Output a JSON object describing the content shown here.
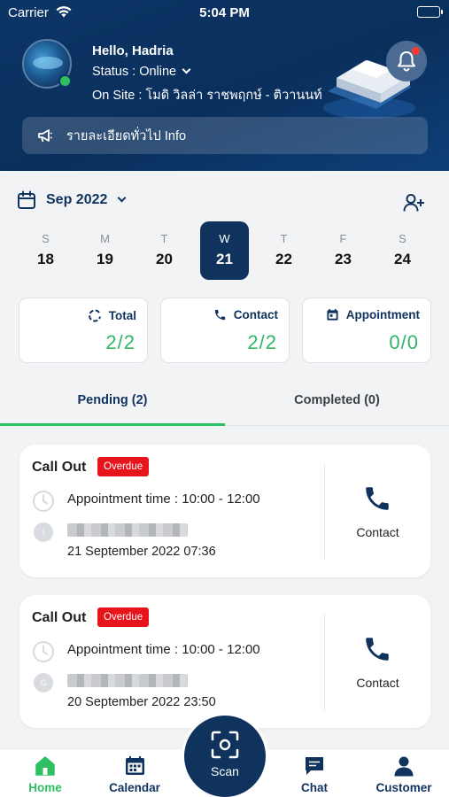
{
  "status_bar": {
    "carrier": "Carrier",
    "time": "5:04 PM"
  },
  "profile": {
    "greeting": "Hello, Hadria",
    "status": "Status : Online",
    "on_site": "On Site : โมดิ วิลล่า ราชพฤกษ์ - ติวานนท์"
  },
  "info_bar": {
    "label": "รายละเอียดทั่วไป Info"
  },
  "calendar": {
    "month": "Sep 2022",
    "days": [
      {
        "name": "S",
        "date": "18"
      },
      {
        "name": "M",
        "date": "19"
      },
      {
        "name": "T",
        "date": "20"
      },
      {
        "name": "W",
        "date": "21",
        "selected": true
      },
      {
        "name": "T",
        "date": "22"
      },
      {
        "name": "F",
        "date": "23"
      },
      {
        "name": "S",
        "date": "24"
      }
    ]
  },
  "summary": {
    "total": {
      "label": "Total",
      "value": "2/2"
    },
    "contact": {
      "label": "Contact",
      "value": "2/2"
    },
    "appointment": {
      "label": "Appointment",
      "value": "0/0"
    }
  },
  "tabs": {
    "pending": "Pending (2)",
    "completed": "Completed (0)"
  },
  "tasks": [
    {
      "title": "Call Out",
      "badge": "Overdue",
      "appointment": "Appointment time : 10:00 - 12:00",
      "avatar_initial": "I",
      "datetime": "21 September 2022 07:36",
      "action": "Contact"
    },
    {
      "title": "Call Out",
      "badge": "Overdue",
      "appointment": "Appointment time : 10:00 - 12:00",
      "avatar_initial": "G",
      "datetime": "20 September 2022 23:50",
      "action": "Contact"
    }
  ],
  "nav": {
    "home": "Home",
    "calendar": "Calendar",
    "scan": "Scan",
    "chat": "Chat",
    "customer": "Customer"
  },
  "colors": {
    "primary": "#10335e",
    "accent_green": "#2fbf63",
    "overdue_red": "#e8141c",
    "header_bg": "#0c3566"
  },
  "icons": [
    "wifi-icon",
    "battery-icon",
    "bell-icon",
    "megaphone-icon",
    "calendar-icon",
    "add-user-icon",
    "refresh-icon",
    "phone-icon",
    "clock-icon",
    "home-icon",
    "scan-icon",
    "chat-icon",
    "person-icon"
  ]
}
